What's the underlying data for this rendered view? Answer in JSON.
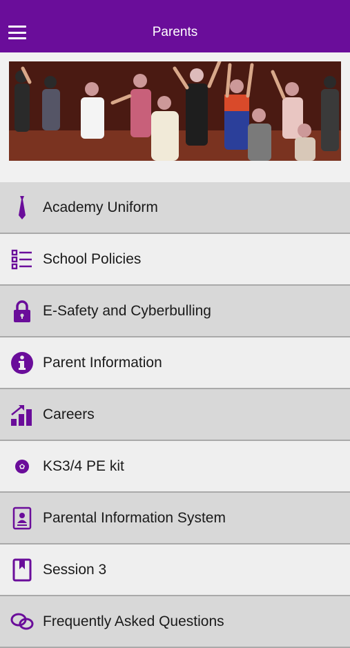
{
  "header": {
    "title": "Parents",
    "menu_icon": "hamburger-menu-icon"
  },
  "banner": {
    "image": "school-performance-photo"
  },
  "accent_color": "#6a0d9a",
  "menu": {
    "items": [
      {
        "label": "Academy Uniform",
        "icon": "tie-icon"
      },
      {
        "label": "School Policies",
        "icon": "list-icon"
      },
      {
        "label": "E-Safety and Cyberbulling",
        "icon": "lock-icon"
      },
      {
        "label": "Parent Information",
        "icon": "info-icon"
      },
      {
        "label": "Careers",
        "icon": "growth-chart-icon"
      },
      {
        "label": "KS3/4 PE kit",
        "icon": "football-icon"
      },
      {
        "label": "Parental Information System",
        "icon": "id-document-icon"
      },
      {
        "label": "Session 3",
        "icon": "bookmark-book-icon"
      },
      {
        "label": "Frequently Asked Questions",
        "icon": "chat-bubbles-icon"
      }
    ]
  }
}
